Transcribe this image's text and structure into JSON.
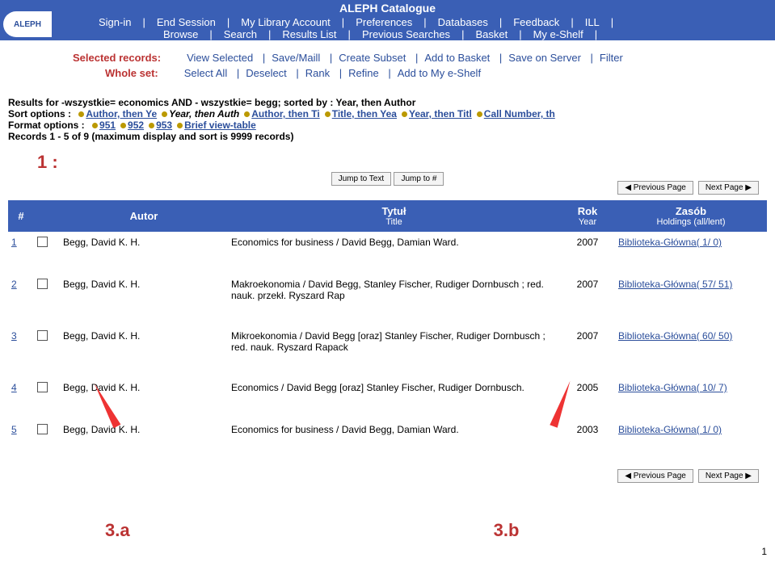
{
  "header": {
    "title": "ALEPH  Catalogue",
    "menu1": [
      "Sign-in",
      "End Session",
      "My Library Account",
      "Preferences",
      "Databases",
      "Feedback",
      "ILL"
    ],
    "menu2": [
      "Browse",
      "Search",
      "Results List",
      "Previous Searches",
      "Basket",
      "My e-Shelf"
    ]
  },
  "logo": "ALEPH",
  "toolbar": {
    "selected_label": "Selected records:",
    "selected_actions": [
      "View Selected",
      "Save/Maill",
      "Create Subset",
      "Add to Basket",
      "Save on Server",
      "Filter"
    ],
    "whole_label": "Whole set:",
    "whole_actions": [
      "Select All",
      "Deselect",
      "Rank",
      "Refine",
      "Add to My e-Shelf"
    ]
  },
  "results_info": {
    "query": "Results for -wszystkie= economics AND - wszystkie= begg; sorted by : Year, then Author",
    "sort_label": "Sort options :",
    "sort_options": [
      {
        "text": "Author, then Ye",
        "link": true
      },
      {
        "text": "Year, then Auth",
        "link": false,
        "italic": true
      },
      {
        "text": "Author, then Ti",
        "link": true
      },
      {
        "text": "Title, then Yea",
        "link": true
      },
      {
        "text": "Year, then Titl",
        "link": true
      },
      {
        "text": "Call Number, th",
        "link": true
      }
    ],
    "format_label": "Format options :",
    "format_options": [
      "951",
      "952",
      "953",
      "Brief view-table"
    ],
    "records_line": "Records 1 - 5 of  9 (maximum display and sort is 9999 records)"
  },
  "index_label": "1 :",
  "buttons": {
    "jump_text": "Jump to Text",
    "jump_num": "Jump to #",
    "prev": "◀ Previous Page",
    "next": "Next Page ▶"
  },
  "table": {
    "headers": {
      "num": "#",
      "author": "Autor",
      "title": "Tytuł",
      "title_sub": "Title",
      "year": "Rok",
      "year_sub": "Year",
      "holdings": "Zasób",
      "holdings_sub": "Holdings (all/lent)"
    },
    "rows": [
      {
        "n": "1",
        "author": "Begg, David K. H.",
        "title": "Economics for business / David Begg, Damian Ward.",
        "year": "2007",
        "holdings": "Biblioteka-Główna( 1/ 0)"
      },
      {
        "n": "2",
        "author": "Begg, David K. H.",
        "title": "Makroekonomia / David Begg, Stanley Fischer, Rudiger Dornbusch ; red. nauk. przekł. Ryszard Rap",
        "year": "2007",
        "holdings": "Biblioteka-Główna( 57/ 51)"
      },
      {
        "n": "3",
        "author": "Begg, David K. H.",
        "title": "Mikroekonomia / David Begg [oraz] Stanley Fischer, Rudiger Dornbusch ; red. nauk. Ryszard Rapack",
        "year": "2007",
        "holdings": "Biblioteka-Główna( 60/ 50)"
      },
      {
        "n": "4",
        "author": "Begg, David K. H.",
        "title": "Economics / David Begg [oraz] Stanley Fischer, Rudiger Dornbusch.",
        "year": "2005",
        "holdings": "Biblioteka-Główna( 10/ 7)"
      },
      {
        "n": "5",
        "author": "Begg, David K. H.",
        "title": "Economics for business / David Begg, Damian Ward.",
        "year": "2003",
        "holdings": "Biblioteka-Główna( 1/ 0)"
      }
    ]
  },
  "footer": {
    "a": "3.a",
    "b": "3.b",
    "page": "1"
  }
}
